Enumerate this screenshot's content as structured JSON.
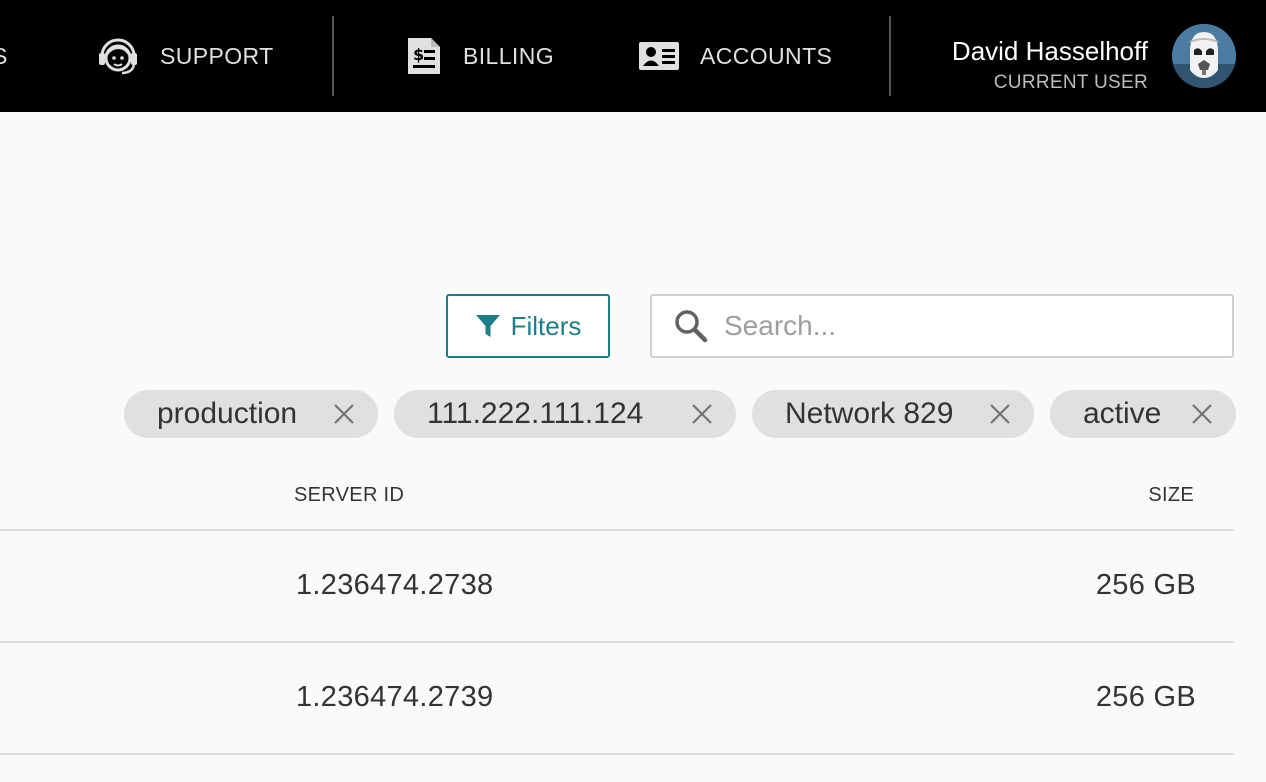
{
  "nav": {
    "cut_label": "S",
    "support": {
      "label": "SUPPORT",
      "icon": "headset-icon"
    },
    "billing": {
      "label": "BILLING",
      "icon": "invoice-icon"
    },
    "accounts": {
      "label": "ACCOUNTS",
      "icon": "id-card-icon"
    }
  },
  "user": {
    "name": "David Hasselhoff",
    "role": "CURRENT USER"
  },
  "toolbar": {
    "filters_label": "Filters",
    "search_placeholder": "Search..."
  },
  "chips": [
    {
      "label": "production"
    },
    {
      "label": "111.222.111.124"
    },
    {
      "label": "Network 829"
    },
    {
      "label": "active"
    }
  ],
  "table": {
    "headers": {
      "server_id": "SERVER ID",
      "size": "SIZE"
    },
    "rows": [
      {
        "server_id": "1.236474.2738",
        "size": "256 GB"
      },
      {
        "server_id": "1.236474.2739",
        "size": "256 GB"
      }
    ]
  },
  "colors": {
    "accent": "#1a7f86",
    "topbar": "#000000",
    "chip_bg": "#e0e0e0",
    "page_bg": "#fafafa"
  }
}
